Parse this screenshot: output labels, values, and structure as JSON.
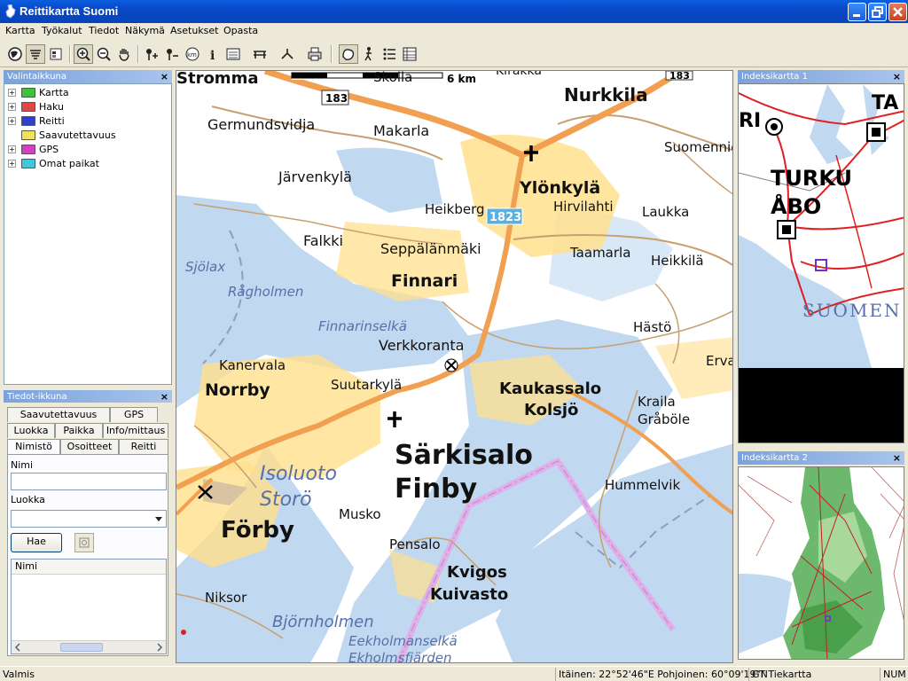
{
  "window": {
    "title": "Reittikartta Suomi"
  },
  "menu": [
    "Kartta",
    "Työkalut",
    "Tiedot",
    "Näkymä",
    "Asetukset",
    "Opasta"
  ],
  "toolbar": {
    "icons": [
      "globe-icon",
      "layers-icon",
      "legend-icon",
      "zoom-in-icon",
      "zoom-out-icon",
      "pan-hand-icon",
      "add-point-icon",
      "remove-point-icon",
      "distance-icon",
      "info-icon",
      "calculator-icon",
      "bridge-icon",
      "route-tools-icon",
      "print-icon",
      "area-select-icon",
      "walker-icon",
      "list-icon",
      "table-icon"
    ]
  },
  "selection_panel": {
    "title": "Valintaikkuna",
    "close": "×",
    "items": [
      {
        "label": "Kartta",
        "color": "#3fc03f",
        "expandable": true
      },
      {
        "label": "Haku",
        "color": "#e04848",
        "expandable": true
      },
      {
        "label": "Reitti",
        "color": "#3040c8",
        "expandable": true
      },
      {
        "label": "Saavutettavuus",
        "color": "#f0e060",
        "expandable": false
      },
      {
        "label": "GPS",
        "color": "#d040c0",
        "expandable": true
      },
      {
        "label": "Omat paikat",
        "color": "#40c8d8",
        "expandable": true
      }
    ]
  },
  "info_panel": {
    "title": "Tiedot-ikkuna",
    "close": "×",
    "tabs_row1": [
      "Saavutettavuus",
      "GPS"
    ],
    "tabs_row2": [
      "Luokka",
      "Paikka",
      "Info/mittaus"
    ],
    "tabs_row3": [
      "Nimistö",
      "Osoitteet",
      "Reitti"
    ],
    "active_tab": "Nimistö",
    "name_label": "Nimi",
    "name_value": "",
    "class_label": "Luokka",
    "class_value": "",
    "search_button": "Hae",
    "result_header": "Nimi"
  },
  "map": {
    "scale_label": "6 km",
    "labels": [
      {
        "text": "Germundsvidja",
        "size": 16,
        "style": "normal",
        "weight": "normal"
      },
      {
        "text": "Makarla",
        "size": 16
      },
      {
        "text": "Nurkkila",
        "size": 20,
        "weight": "bold"
      },
      {
        "text": "Järvenkylä",
        "size": 16
      },
      {
        "text": "Ylönkylä",
        "size": 19,
        "weight": "bold"
      },
      {
        "text": "Hirvilahti",
        "size": 15
      },
      {
        "text": "Laukka",
        "size": 15
      },
      {
        "text": "Suomennie",
        "size": 15
      },
      {
        "text": "Heikberg",
        "size": 15
      },
      {
        "text": "Falkki",
        "size": 16
      },
      {
        "text": "Seppälänmäki",
        "size": 16
      },
      {
        "text": "Taamarla",
        "size": 15
      },
      {
        "text": "Heikkilä",
        "size": 15
      },
      {
        "text": "Finnari",
        "size": 19,
        "weight": "bold"
      },
      {
        "text": "Sjölax",
        "size": 15,
        "style": "italic",
        "color": "#5870a8"
      },
      {
        "text": "Rågholmen",
        "size": 15,
        "style": "italic",
        "color": "#5870a8"
      },
      {
        "text": "Finnarinselkä",
        "size": 15,
        "style": "italic",
        "color": "#5870a8"
      },
      {
        "text": "Verkkoranta",
        "size": 16
      },
      {
        "text": "Hästö",
        "size": 15
      },
      {
        "text": "Kanervala",
        "size": 15
      },
      {
        "text": "Norrby",
        "size": 19,
        "weight": "bold"
      },
      {
        "text": "Suutarkylä",
        "size": 15
      },
      {
        "text": "Kaukassalo",
        "size": 18,
        "weight": "bold"
      },
      {
        "text": "Kolsjö",
        "size": 18,
        "weight": "bold"
      },
      {
        "text": "Kraila",
        "size": 15
      },
      {
        "text": "Gråböle",
        "size": 15
      },
      {
        "text": "Ervas",
        "size": 15
      },
      {
        "text": "Särkisalo",
        "size": 30,
        "weight": "bold"
      },
      {
        "text": "Finby",
        "size": 30,
        "weight": "bold"
      },
      {
        "text": "Isoluoto",
        "size": 22,
        "style": "italic",
        "color": "#5870a8"
      },
      {
        "text": "Storö",
        "size": 22,
        "style": "italic",
        "color": "#5870a8"
      },
      {
        "text": "Hummelvik",
        "size": 15
      },
      {
        "text": "Förby",
        "size": 26,
        "weight": "bold"
      },
      {
        "text": "Musko",
        "size": 15
      },
      {
        "text": "Pensalo",
        "size": 15
      },
      {
        "text": "Kvigos",
        "size": 18,
        "weight": "bold"
      },
      {
        "text": "Kuivasto",
        "size": 18,
        "weight": "bold"
      },
      {
        "text": "Niksor",
        "size": 15
      },
      {
        "text": "Björnholmen",
        "size": 18,
        "style": "italic",
        "color": "#5870a8"
      },
      {
        "text": "Eekholmanselkä",
        "size": 15,
        "style": "italic",
        "color": "#5870a8"
      },
      {
        "text": "Ekholmsfjärden",
        "size": 15,
        "style": "italic",
        "color": "#5870a8"
      },
      {
        "text": "Skolla",
        "size": 15
      },
      {
        "text": "Kirakka",
        "size": 14
      },
      {
        "text": "Stromma",
        "size": 18,
        "weight": "bold"
      }
    ],
    "road_shields": [
      "183",
      "1823",
      "183"
    ]
  },
  "index_map_1": {
    "title": "Indeksikartta 1",
    "close": "×",
    "labels": [
      "TURKU",
      "ÅBO",
      "SUOMEN",
      "RI",
      "TA"
    ]
  },
  "index_map_2": {
    "title": "Indeksikartta 2",
    "close": "×"
  },
  "status": {
    "state": "Valmis",
    "coords": "Itäinen:  22°52'46\"E Pohjoinen:  60°09'19\"N",
    "map_type": "GT Tiekartta",
    "num": "NUM"
  },
  "colors": {
    "water": "#c0d8f0",
    "land": "#ffffff",
    "urban": "#ffe08c",
    "road_main": "#f0a050",
    "road_minor": "#c8a070"
  }
}
